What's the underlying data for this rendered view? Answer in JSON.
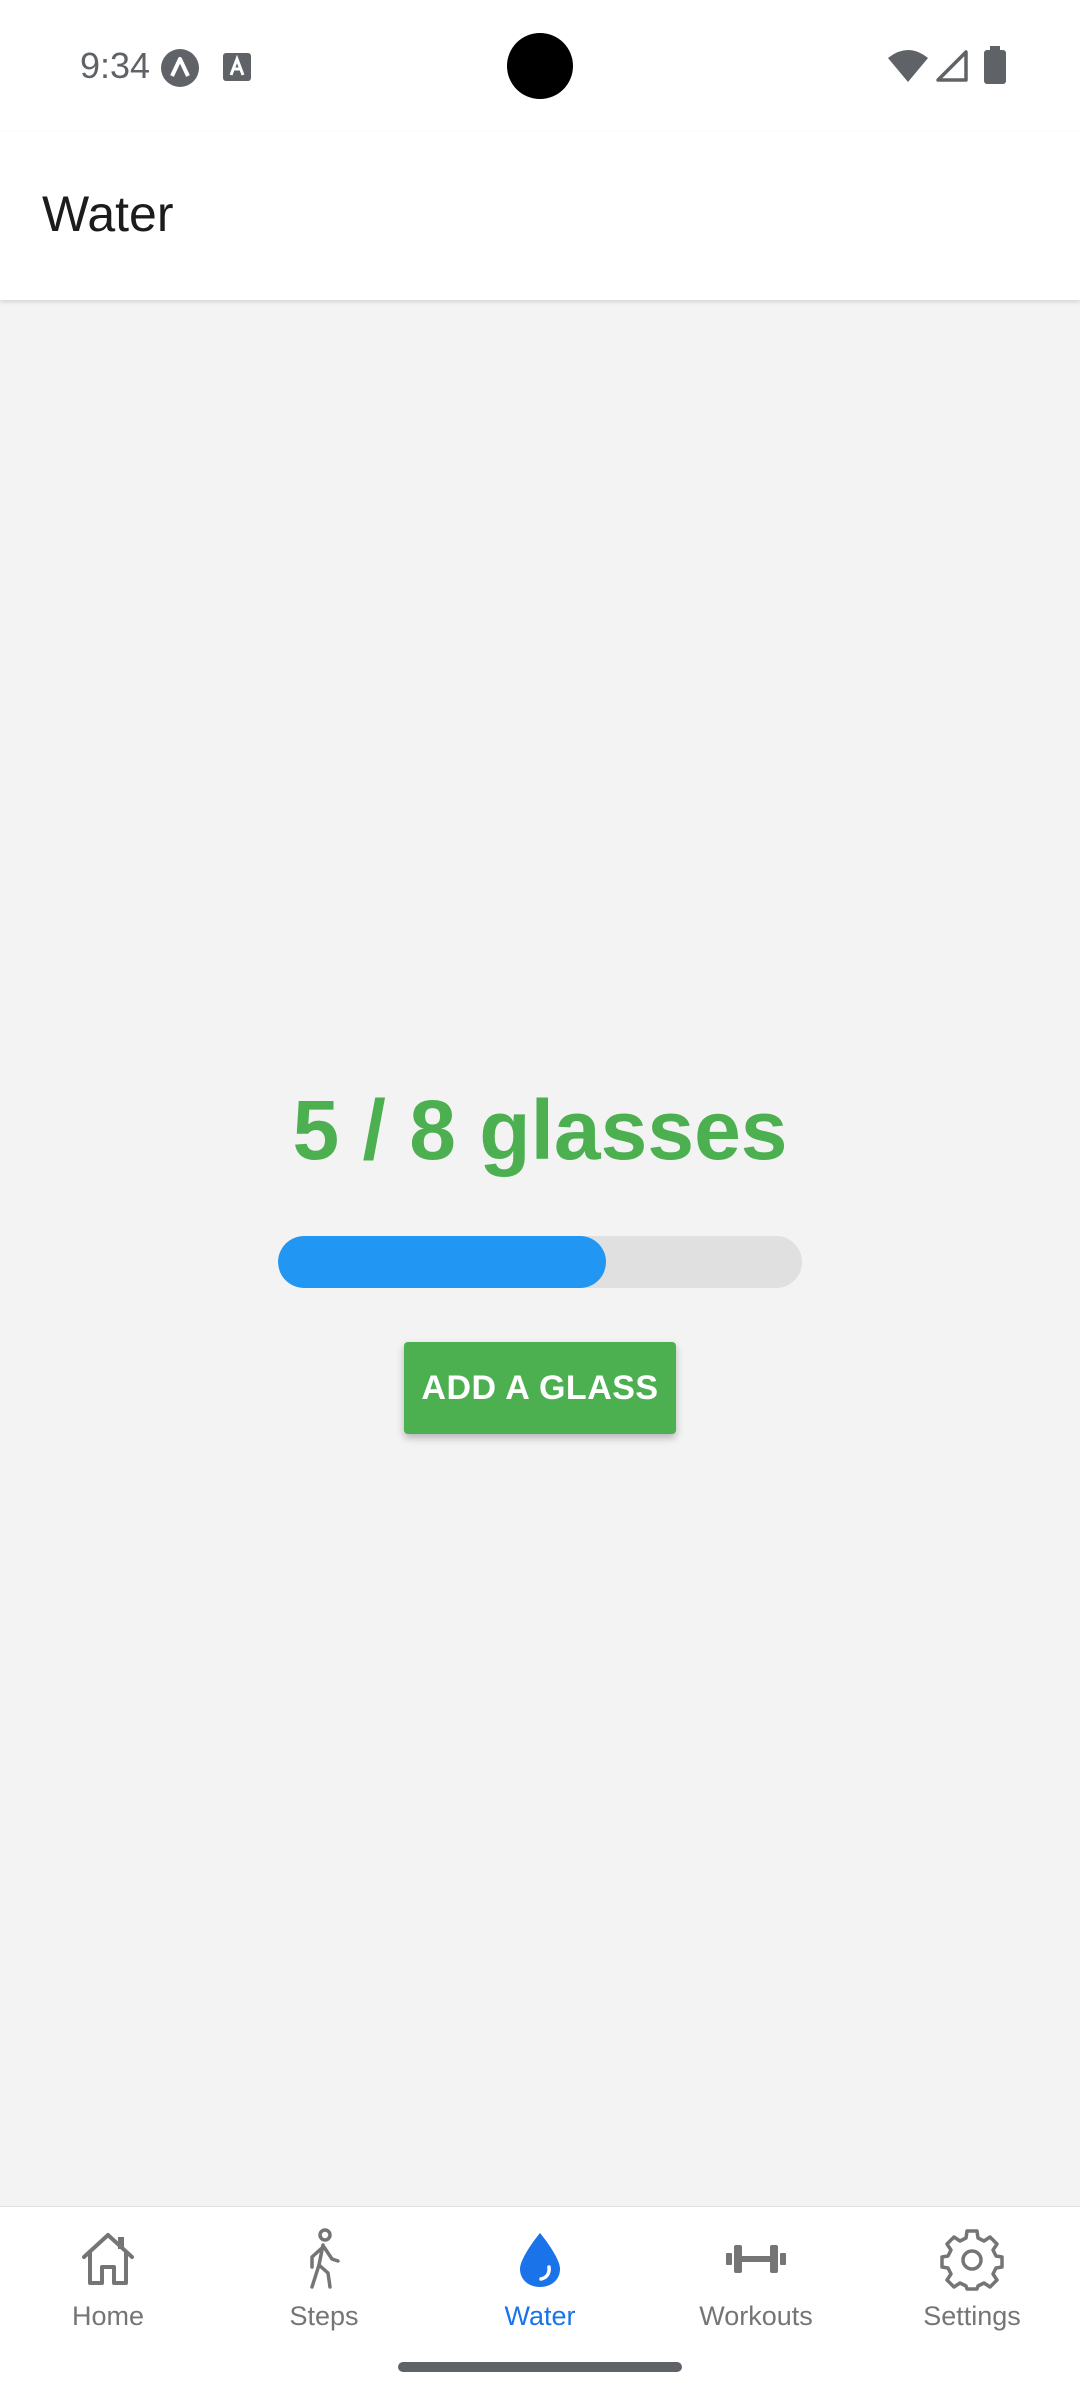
{
  "status_bar": {
    "time": "9:34",
    "icons": [
      "app-notification-icon",
      "font-notification-icon",
      "wifi-icon",
      "cellular-signal-icon",
      "battery-icon"
    ]
  },
  "app_bar": {
    "title": "Water"
  },
  "water": {
    "count_text": "5 / 8 glasses",
    "glasses_consumed": 5,
    "glasses_goal": 8,
    "progress_fraction": 0.625,
    "add_button_label": "ADD A GLASS"
  },
  "bottom_nav": {
    "items": [
      {
        "label": "Home",
        "icon": "home-icon",
        "active": false
      },
      {
        "label": "Steps",
        "icon": "walking-icon",
        "active": false
      },
      {
        "label": "Water",
        "icon": "water-drop-icon",
        "active": true
      },
      {
        "label": "Workouts",
        "icon": "dumbbell-icon",
        "active": false
      },
      {
        "label": "Settings",
        "icon": "gear-icon",
        "active": false
      }
    ]
  },
  "colors": {
    "accent_green": "#4caf50",
    "progress_blue": "#2196f3",
    "progress_track": "#e0e0e0",
    "active_nav": "#1a73e8",
    "inactive_nav": "#757575",
    "background": "#f3f3f3"
  }
}
